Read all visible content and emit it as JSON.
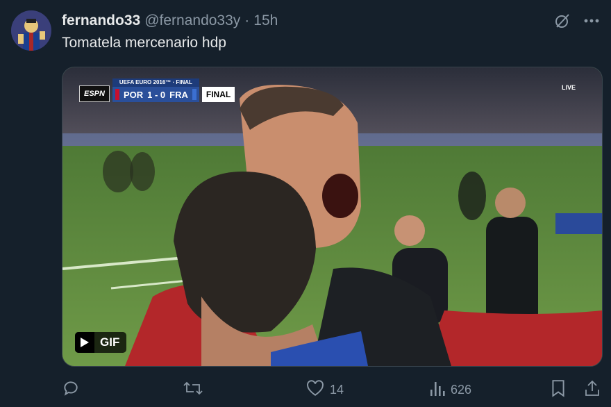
{
  "tweet": {
    "display_name": "fernando33",
    "handle": "@fernando33y",
    "separator": "·",
    "time": "15h",
    "text": "Tomatela mercenario hdp"
  },
  "media": {
    "scorebug": {
      "network": "ESPN",
      "competition": "UEFA EURO 2016™ · FINAL",
      "home": "POR",
      "score": "1 - 0",
      "away": "FRA",
      "status": "FINAL",
      "live": "LIVE"
    },
    "badge_label": "GIF"
  },
  "actions": {
    "reply_count": "",
    "retweet_count": "",
    "like_count": "14",
    "views_count": "626"
  },
  "colors": {
    "background": "#15202b",
    "text_primary": "#e7e9ea",
    "text_secondary": "#8b98a5",
    "border": "#38444d"
  },
  "icons": {
    "grok": "grok-icon",
    "more": "more-icon",
    "reply": "reply-icon",
    "retweet": "retweet-icon",
    "like": "heart-icon",
    "views": "views-icon",
    "bookmark": "bookmark-icon",
    "share": "share-icon",
    "play": "play-icon"
  }
}
